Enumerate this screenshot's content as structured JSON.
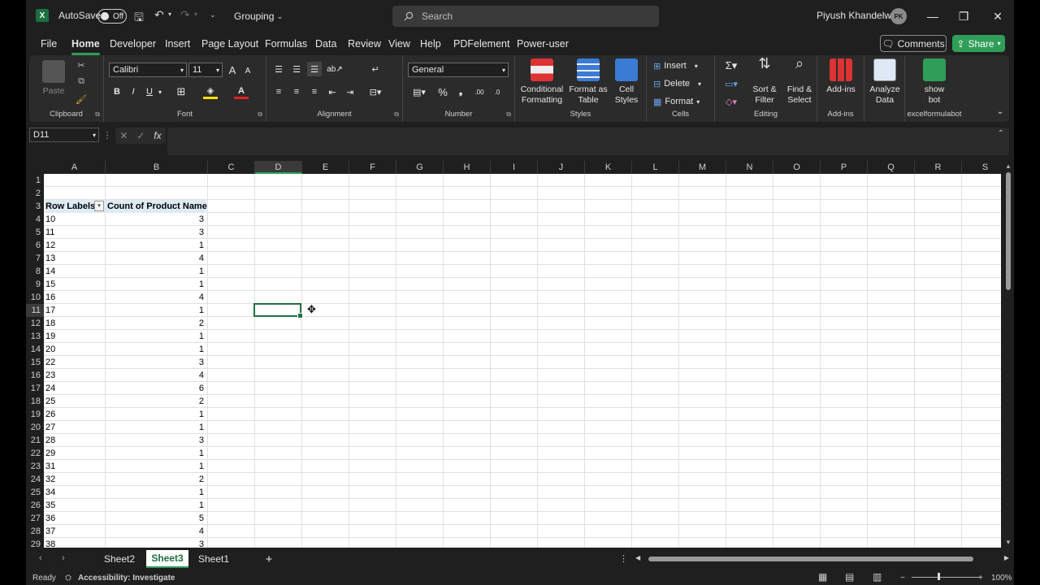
{
  "app": {
    "autosave_label": "AutoSave",
    "autosave_state": "Off",
    "doc_title": "Grouping",
    "search_placeholder": "Search",
    "user_name": "Piyush Khandelwal",
    "user_initials": "PK"
  },
  "menu": {
    "items": [
      "File",
      "Home",
      "Developer",
      "Insert",
      "Page Layout",
      "Formulas",
      "Data",
      "Review",
      "View",
      "Help",
      "PDFelement",
      "Power-user"
    ],
    "comments": "Comments",
    "share": "Share"
  },
  "ribbon": {
    "clipboard": {
      "paste": "Paste",
      "label": "Clipboard"
    },
    "font": {
      "name": "Calibri",
      "size": "11",
      "label": "Font",
      "bold": "B",
      "italic": "I",
      "underline": "U"
    },
    "alignment": {
      "label": "Alignment"
    },
    "number": {
      "format": "General",
      "label": "Number"
    },
    "styles": {
      "conditional": "Conditional Formatting",
      "format_table": "Format as Table",
      "cell_styles": "Cell Styles",
      "label": "Styles"
    },
    "cells": {
      "insert": "Insert",
      "delete": "Delete",
      "format": "Format",
      "label": "Cells"
    },
    "editing": {
      "sort": "Sort & Filter",
      "find": "Find & Select",
      "label": "Editing"
    },
    "addins": {
      "addins": "Add-ins",
      "label": "Add-ins"
    },
    "analyze": {
      "label": "Analyze Data"
    },
    "bot": {
      "btn": "show bot",
      "label": "excelformulabot"
    }
  },
  "formula_bar": {
    "name_box": "D11",
    "fx": "fx",
    "content": ""
  },
  "columns": [
    "A",
    "B",
    "C",
    "D",
    "E",
    "F",
    "G",
    "H",
    "I",
    "J",
    "K",
    "L",
    "M",
    "N",
    "O",
    "P",
    "Q",
    "R",
    "S"
  ],
  "selected_column": "D",
  "selected_row": "11",
  "rows": [
    "1",
    "2",
    "3",
    "4",
    "5",
    "6",
    "7",
    "8",
    "9",
    "10",
    "11",
    "12",
    "13",
    "14",
    "15",
    "16",
    "17",
    "18",
    "19",
    "20",
    "21",
    "22",
    "23",
    "24",
    "25",
    "26",
    "27",
    "28",
    "29"
  ],
  "pivot": {
    "header_a": "Row Labels",
    "header_b": "Count of Product Name",
    "labels": [
      "10",
      "11",
      "12",
      "13",
      "14",
      "15",
      "16",
      "17",
      "18",
      "19",
      "20",
      "22",
      "23",
      "24",
      "25",
      "26",
      "27",
      "28",
      "29",
      "31",
      "32",
      "34",
      "35",
      "36",
      "37",
      "38"
    ],
    "counts": [
      "3",
      "3",
      "1",
      "4",
      "1",
      "1",
      "4",
      "1",
      "2",
      "1",
      "1",
      "3",
      "4",
      "6",
      "2",
      "1",
      "1",
      "3",
      "1",
      "1",
      "2",
      "1",
      "1",
      "5",
      "4",
      "3"
    ]
  },
  "sheets": {
    "tabs": [
      "Sheet2",
      "Sheet3",
      "Sheet1"
    ],
    "active": "Sheet3",
    "add": "+"
  },
  "status": {
    "ready": "Ready",
    "accessibility": "Accessibility: Investigate",
    "zoom": "100%"
  }
}
